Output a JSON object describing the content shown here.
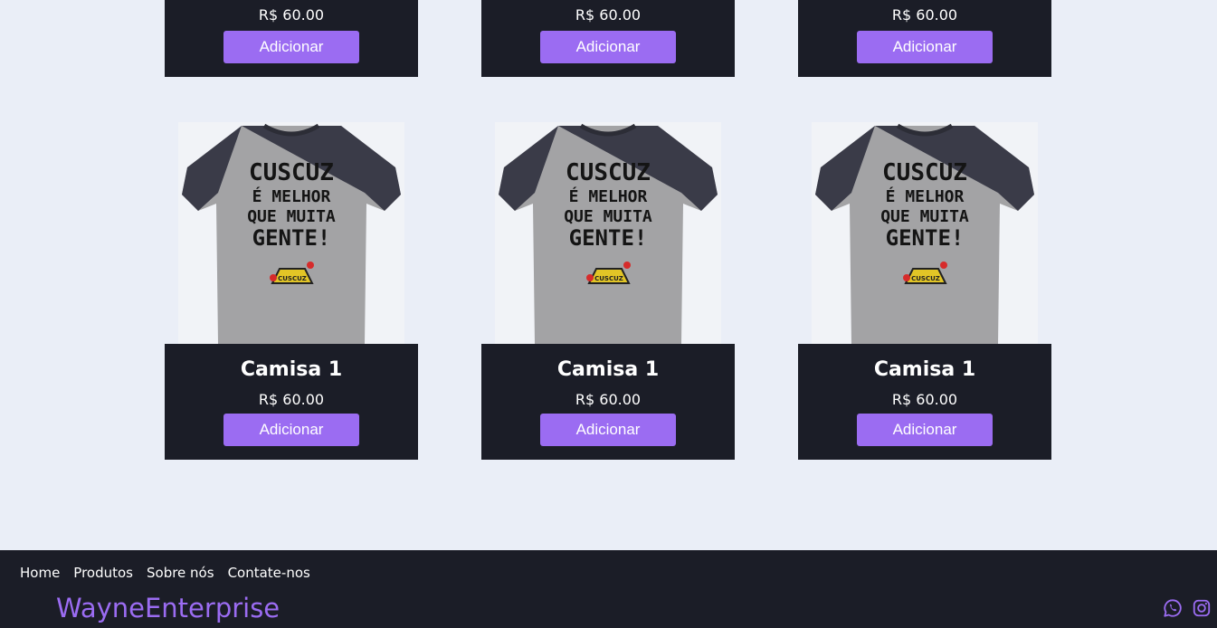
{
  "top_row": [
    {
      "price": "R$ 60.00",
      "button": "Adicionar"
    },
    {
      "price": "R$ 60.00",
      "button": "Adicionar"
    },
    {
      "price": "R$ 60.00",
      "button": "Adicionar"
    }
  ],
  "products": [
    {
      "name": "Camisa 1",
      "price": "R$ 60.00",
      "button": "Adicionar",
      "image_text": [
        "CUSCUZ",
        "É MELHOR",
        "QUE MUITA",
        "GENTE!"
      ],
      "badge_text": "CUSCUZ"
    },
    {
      "name": "Camisa 1",
      "price": "R$ 60.00",
      "button": "Adicionar",
      "image_text": [
        "CUSCUZ",
        "É MELHOR",
        "QUE MUITA",
        "GENTE!"
      ],
      "badge_text": "CUSCUZ"
    },
    {
      "name": "Camisa 1",
      "price": "R$ 60.00",
      "button": "Adicionar",
      "image_text": [
        "CUSCUZ",
        "É MELHOR",
        "QUE MUITA",
        "GENTE!"
      ],
      "badge_text": "CUSCUZ"
    }
  ],
  "footer": {
    "nav": [
      "Home",
      "Produtos",
      "Sobre nós",
      "Contate-nos"
    ],
    "brand": "WayneEnterprise",
    "social_icons": [
      "whatsapp-icon",
      "instagram-icon"
    ]
  },
  "colors": {
    "background": "#eaeef7",
    "card": "#1b1d27",
    "accent": "#9b6cf2"
  }
}
